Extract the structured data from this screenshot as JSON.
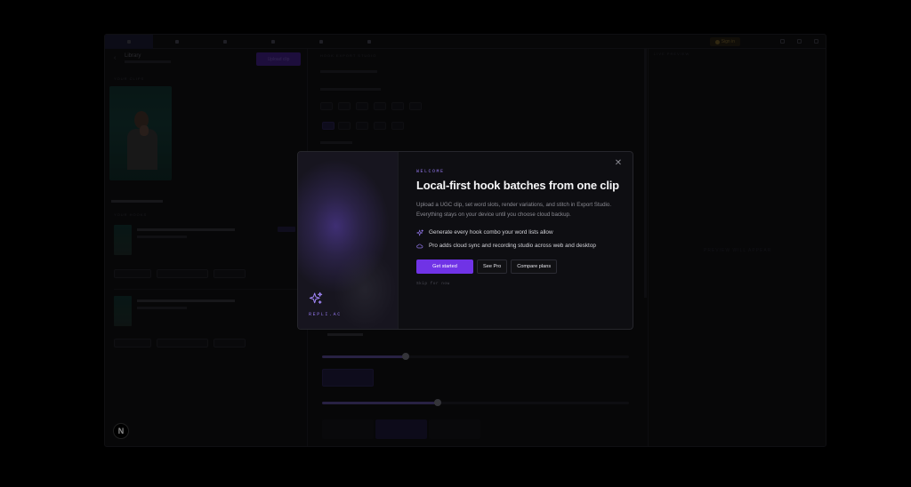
{
  "background_app": {
    "library_title": "Library",
    "upload_label": "Upload clip",
    "sections": {
      "clips": "YOUR CLIPS",
      "hooks": "YOUR HOOKS"
    },
    "panel_title": "HOOK EXPORT STUDIO",
    "preview_label": "LIVE PREVIEW",
    "preview_placeholder": "PREVIEW WILL APPEAR",
    "signin_label": "Sign in"
  },
  "modal": {
    "eyebrow": "WELCOME",
    "title": "Local-first hook batches from one clip",
    "description": "Upload a UGC clip, set word slots, render variations, and stitch in Export Studio. Everything stays on your device until you choose cloud backup.",
    "features": [
      {
        "icon": "sparkle-icon",
        "text": "Generate every hook combo your word lists allow"
      },
      {
        "icon": "cloud-icon",
        "text": "Pro adds cloud sync and recording studio across web and desktop"
      }
    ],
    "buttons": {
      "primary": "Get started",
      "secondary": "See Pro",
      "tertiary": "Compare plans"
    },
    "skip_label": "Skip for now",
    "brand": "REPLI.AC",
    "close_icon": "close-icon"
  },
  "colors": {
    "accent": "#7033e6",
    "accent_text": "#8f74e6",
    "modal_bg": "#0e0e12",
    "page_bg": "#000000"
  },
  "framework_badge": "N"
}
